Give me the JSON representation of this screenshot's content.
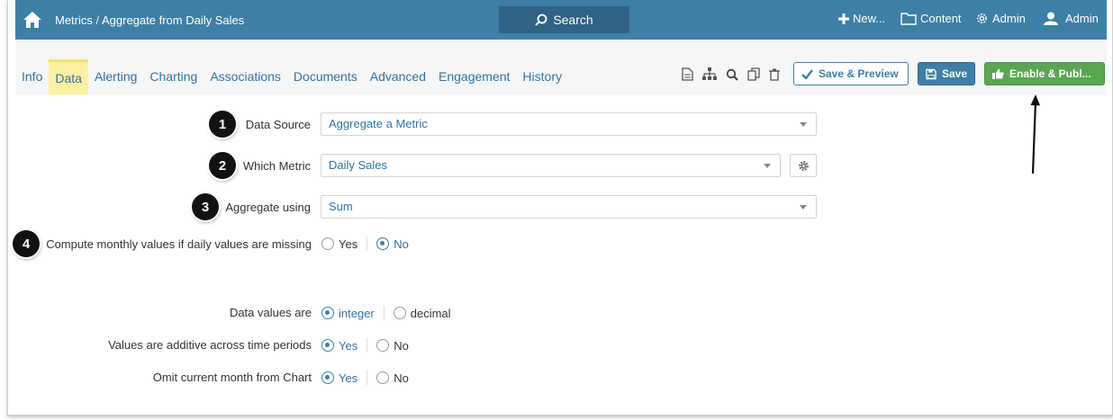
{
  "header": {
    "breadcrumb_root": "Metrics",
    "breadcrumb_sep": " / ",
    "breadcrumb_page": "Aggregate from Daily Sales",
    "search_label": "Search",
    "new_label": "New...",
    "content_label": "Content",
    "admin_label": "Admin",
    "user_label": "Admin"
  },
  "tabs": [
    {
      "label": "Info"
    },
    {
      "label": "Data"
    },
    {
      "label": "Alerting"
    },
    {
      "label": "Charting"
    },
    {
      "label": "Associations"
    },
    {
      "label": "Documents"
    },
    {
      "label": "Advanced"
    },
    {
      "label": "Engagement"
    },
    {
      "label": "History"
    }
  ],
  "toolbar": {
    "save_preview_label": "Save & Preview",
    "save_label": "Save",
    "enable_label": "Enable & Publ..."
  },
  "form": {
    "data_source_label": "Data Source",
    "data_source_value": "Aggregate a Metric",
    "which_metric_label": "Which Metric",
    "which_metric_value": "Daily Sales",
    "aggregate_label": "Aggregate using",
    "aggregate_value": "Sum",
    "compute_label": "Compute monthly values if daily values are missing",
    "compute_yes": "Yes",
    "compute_no": "No",
    "data_values_label": "Data values are",
    "data_values_integer": "integer",
    "data_values_decimal": "decimal",
    "additive_label": "Values are additive across time periods",
    "additive_yes": "Yes",
    "additive_no": "No",
    "omit_label": "Omit current month from Chart",
    "omit_yes": "Yes",
    "omit_no": "No"
  },
  "badges": [
    "1",
    "2",
    "3",
    "4"
  ],
  "colors": {
    "topbar": "#3e7fa6",
    "active_tab": "#fbf1a0",
    "enable_button": "#5aa653",
    "link": "#3273a3"
  }
}
